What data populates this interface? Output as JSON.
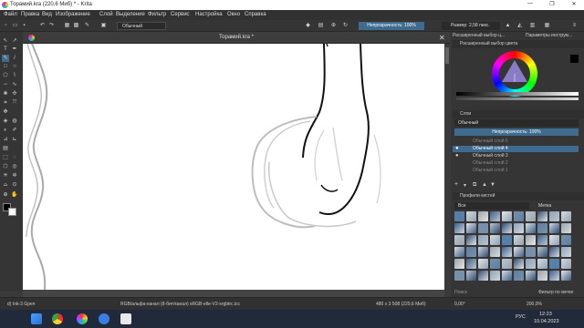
{
  "window": {
    "title": "Торамий.kra (220,6 Миб)  *  - Krita",
    "controls": [
      "—",
      "❐",
      "✕"
    ]
  },
  "menu": [
    "Файл",
    "Правка",
    "Вид",
    "Изображение",
    "Слой",
    "Выделение",
    "Фильтр",
    "Сервис",
    "Настройка",
    "Окно",
    "Справка"
  ],
  "toolbar": {
    "blend_mode": "Обычный",
    "opacity": "Непрозрачность: 100%",
    "size": "Размер: 2,58 пикс."
  },
  "document": {
    "tab_title": "Торамий.kra *"
  },
  "dockers": {
    "color_tabs": [
      "Расширенный выбор ц...",
      "Параметры инструм..."
    ],
    "color_title": "Расширенный выбор цвета",
    "layers_title": "Слои",
    "layers_blend": "Обычный",
    "layers_opacity": "Непрозрачность: 100%",
    "layers": [
      {
        "name": "Обычный слой 5",
        "active": false,
        "visible": false
      },
      {
        "name": "Обычный слой 4",
        "active": true,
        "visible": true
      },
      {
        "name": "Обычный слой 3",
        "active": false,
        "visible": true
      },
      {
        "name": "Обычный слой 2",
        "active": false,
        "visible": false
      },
      {
        "name": "Обычный слой 1",
        "active": false,
        "visible": false
      }
    ],
    "brushes_title": "Профили кистей",
    "brushes_filter": "Все",
    "brushes_tag": "Метка",
    "brushes_search": "Поиск",
    "brushes_filter_by_tag": "Фильтр по метке"
  },
  "status": {
    "brush": "d) Ink-3 Gpen",
    "color_space": "RGB/альфа-канал (8-бит/канал)  sRGB-elle-V2-srgbtrc.icc",
    "dimensions": "480 x 3 508 (220,6 Миб)",
    "rotation": "0,00°",
    "zoom": "200,0%"
  },
  "taskbar": {
    "lang": "РУС",
    "time": "12:23",
    "date": "10.04.2023"
  },
  "colors": {
    "accent": "#3f6b8f",
    "canvas": "#ffffff",
    "ui_bg": "#353535"
  }
}
